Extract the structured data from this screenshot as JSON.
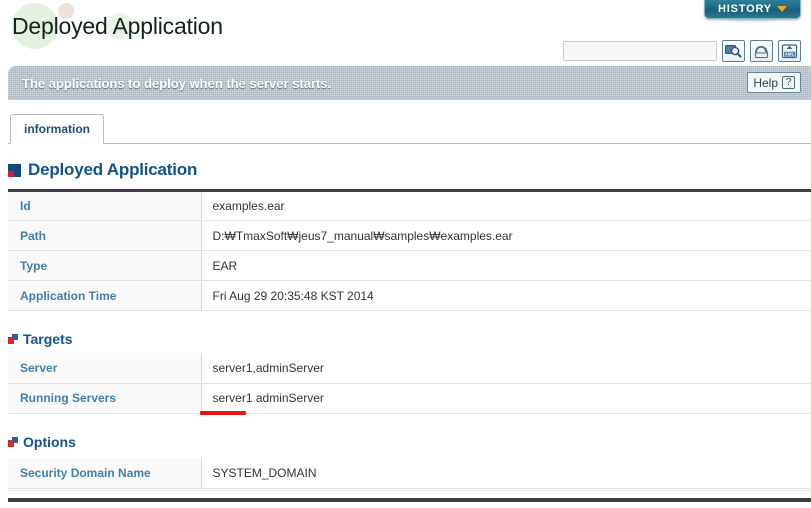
{
  "page": {
    "title": "Deployed Application",
    "description": "The applications to deploy when the server starts."
  },
  "topbar": {
    "history_label": "HISTORY",
    "history_chevron_icon": "chevron-down-icon",
    "search_value": "",
    "search_placeholder": "",
    "buttons": [
      {
        "name": "search-button",
        "icon": "magnifier-icon"
      },
      {
        "name": "refresh-button",
        "icon": "refresh-arrows-icon"
      },
      {
        "name": "export-xml-button",
        "icon": "xml-export-icon",
        "label": "XML"
      }
    ]
  },
  "help": {
    "label": "Help",
    "icon": "question-mark-icon",
    "glyph": "?"
  },
  "tabs": [
    {
      "label": "information",
      "active": true
    }
  ],
  "sections": {
    "main": {
      "title": "Deployed Application",
      "rows": [
        {
          "key": "Id",
          "value": "examples.ear"
        },
        {
          "key": "Path",
          "value": "D:₩TmaxSoft₩jeus7_manual₩samples₩examples.ear"
        },
        {
          "key": "Type",
          "value": "EAR"
        },
        {
          "key": "Application Time",
          "value": "Fri Aug 29 20:35:48 KST 2014"
        }
      ]
    },
    "targets": {
      "title": "Targets",
      "rows": [
        {
          "key": "Server",
          "value": "server1,adminServer"
        },
        {
          "key": "Running Servers",
          "value": "server1 adminServer"
        }
      ]
    },
    "options": {
      "title": "Options",
      "rows": [
        {
          "key": "Security Domain Name",
          "value": "SYSTEM_DOMAIN"
        }
      ]
    }
  },
  "annotation": {
    "type": "underline",
    "color": "#e81313",
    "target_text": "server1"
  },
  "colors": {
    "heading_blue": "#14528f",
    "label_blue": "#3f7fae",
    "history_teal": "#1e6a85",
    "history_chevron": "#f5a81c",
    "desc_bar": "#aab7c2",
    "rule_dark": "#3c3c42",
    "annotation_red": "#e81313"
  }
}
